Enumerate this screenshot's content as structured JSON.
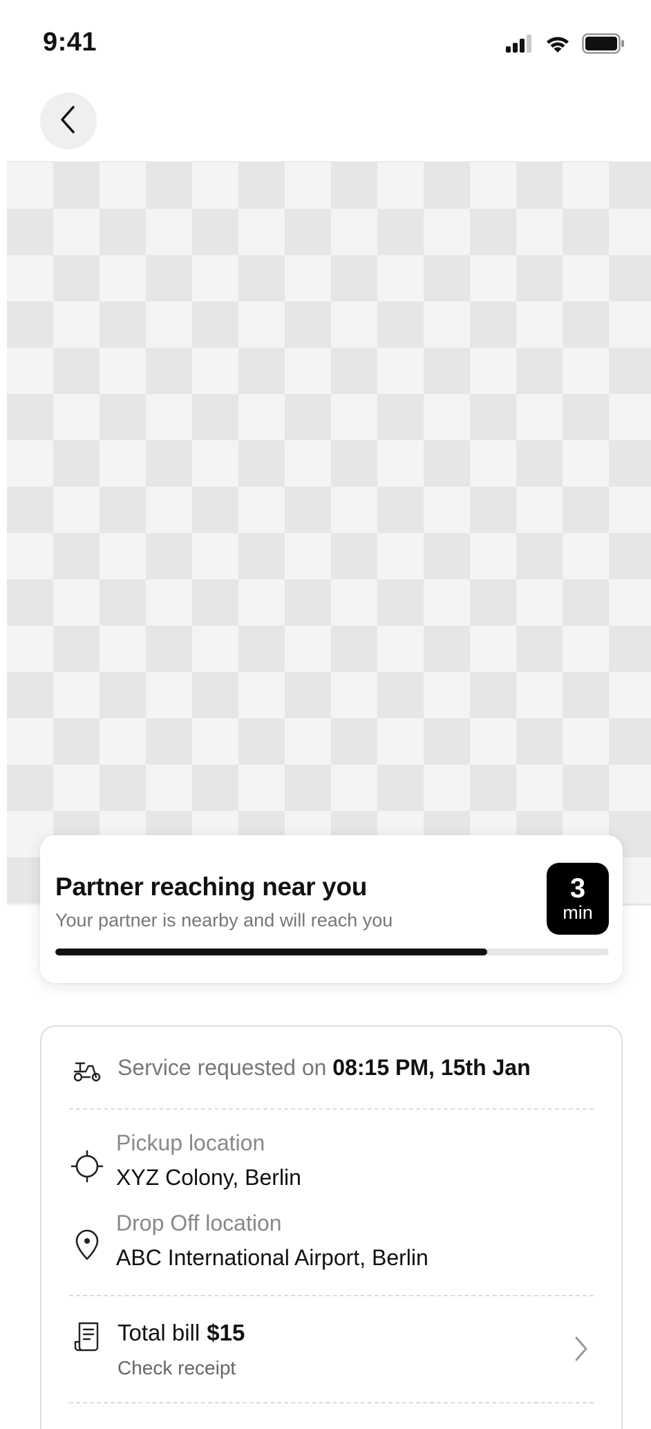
{
  "status_bar": {
    "time": "9:41"
  },
  "eta_card": {
    "title": "Partner reaching near you",
    "subtitle": "Your partner is nearby and will reach you",
    "eta_value": "3",
    "eta_unit": "min",
    "progress_fraction": 0.78
  },
  "details": {
    "service_prefix": "Service requested on",
    "service_datetime": "08:15 PM, 15th Jan",
    "pickup_label": "Pickup location",
    "pickup_value": "XYZ Colony, Berlin",
    "dropoff_label": "Drop Off location",
    "dropoff_value": "ABC International Airport, Berlin",
    "bill_label": "Total bill",
    "bill_amount": "$15",
    "bill_sub": "Check receipt"
  },
  "icons": {
    "back": "chevron-left-icon",
    "service": "scooter-icon",
    "pickup": "crosshair-icon",
    "dropoff": "map-pin-icon",
    "bill": "receipt-icon",
    "bill_action": "chevron-right-icon"
  },
  "colors": {
    "accent": "#000000",
    "progress_track": "#e6e6e6"
  }
}
